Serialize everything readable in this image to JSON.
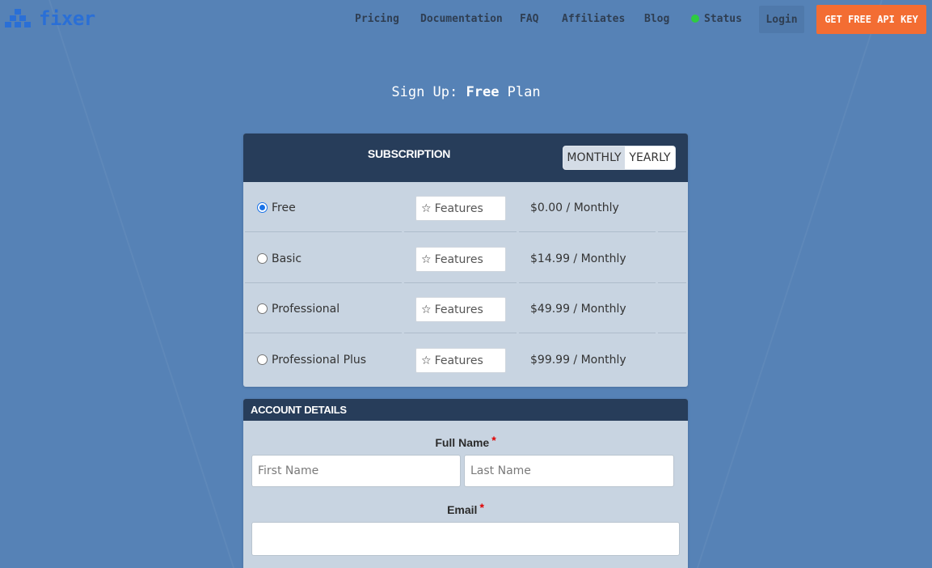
{
  "brand": {
    "name": "fixer",
    "color": "#2a6fd6"
  },
  "nav": {
    "links": [
      "Pricing",
      "Documentation",
      "FAQ",
      "Affiliates",
      "Blog"
    ],
    "status_label": "Status",
    "login_label": "Login",
    "cta_label": "GET FREE API KEY"
  },
  "page": {
    "title_prefix": "Sign Up: ",
    "title_plan": "Free",
    "title_suffix": " Plan"
  },
  "subscription": {
    "header": "SUBSCRIPTION",
    "toggle": {
      "monthly": "MONTHLY",
      "yearly": "YEARLY",
      "selected": "MONTHLY"
    },
    "features_label": "Features",
    "plans": [
      {
        "name": "Free",
        "price": "$0.00 / Monthly",
        "selected": true
      },
      {
        "name": "Basic",
        "price": "$14.99 / Monthly",
        "selected": false
      },
      {
        "name": "Professional",
        "price": "$49.99 / Monthly",
        "selected": false
      },
      {
        "name": "Professional Plus",
        "price": "$99.99 / Monthly",
        "selected": false
      }
    ]
  },
  "account": {
    "header": "ACCOUNT DETAILS",
    "full_name_label": "Full Name",
    "first_name_placeholder": "First Name",
    "last_name_placeholder": "Last Name",
    "email_label": "Email",
    "required_mark": "*"
  },
  "colors": {
    "background": "#5682b6",
    "panel_header": "#273d5a",
    "panel_body": "#c8d4e1",
    "cta": "#f36d33",
    "status_ok": "#2ecc40"
  }
}
